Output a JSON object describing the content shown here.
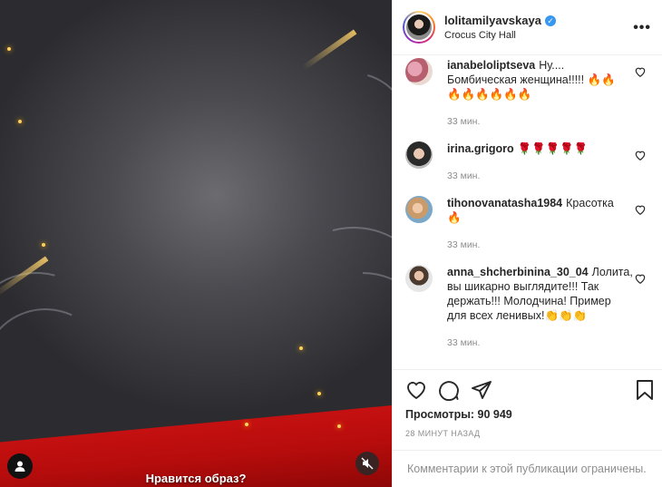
{
  "post": {
    "username": "lolitamilyavskaya",
    "location": "Crocus City Hall",
    "verified_mark": "✓",
    "more_label": "•••",
    "video_caption": "Нравится образ?"
  },
  "comments": [
    {
      "user": "ianabeloliptseva",
      "text": "Ну.... Бомбическая женщина!!!!! 🔥🔥🔥🔥🔥🔥🔥🔥",
      "time": "33 мин."
    },
    {
      "user": "irina.grigoro",
      "text": "🌹🌹🌹🌹🌹",
      "time": "33 мин."
    },
    {
      "user": "tihonovanatasha1984",
      "text": "Красотка 🔥",
      "time": "33 мин."
    },
    {
      "user": "anna_shcherbinina_30_04",
      "text": "Лолита, вы шикарно выглядите!!! Так держать!!! Молодчина! Пример для всех ленивых!👏👏👏",
      "time": "33 мин."
    }
  ],
  "stats": {
    "views": "Просмотры: 90 949",
    "posted_ago": "28 МИНУТ НАЗАД"
  },
  "footer": {
    "comments_closed": "Комментарии к этой публикации ограничены."
  },
  "icons": {
    "like": "heart-icon",
    "comment": "comment-icon",
    "share": "share-icon",
    "save": "bookmark-icon",
    "mute": "muted-speaker-icon",
    "user_tags": "person-icon"
  }
}
